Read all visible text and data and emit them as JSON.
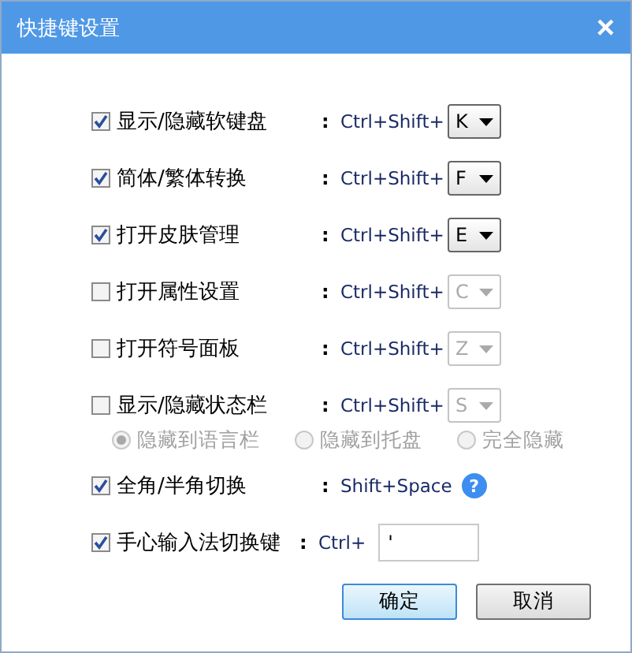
{
  "window": {
    "title": "快捷键设置",
    "close": "×"
  },
  "rows": [
    {
      "kind": "shortcut",
      "label": "显示/隐藏软键盘",
      "checked": true,
      "colon": ":",
      "prefix": "Ctrl+Shift+",
      "key": "K"
    },
    {
      "kind": "shortcut",
      "label": "简体/繁体转换",
      "checked": true,
      "colon": ":",
      "prefix": "Ctrl+Shift+",
      "key": "F"
    },
    {
      "kind": "shortcut",
      "label": "打开皮肤管理",
      "checked": true,
      "colon": ":",
      "prefix": "Ctrl+Shift+",
      "key": "E"
    },
    {
      "kind": "shortcut",
      "label": "打开属性设置",
      "checked": false,
      "colon": ":",
      "prefix": "Ctrl+Shift+",
      "key": "C"
    },
    {
      "kind": "shortcut",
      "label": "打开符号面板",
      "checked": false,
      "colon": ":",
      "prefix": "Ctrl+Shift+",
      "key": "Z"
    },
    {
      "kind": "shortcut",
      "label": "显示/隐藏状态栏",
      "checked": false,
      "colon": ":",
      "prefix": "Ctrl+Shift+",
      "key": "S"
    },
    {
      "kind": "radios",
      "options": [
        {
          "label": "隐藏到语言栏",
          "selected": true,
          "disabled": true
        },
        {
          "label": "隐藏到托盘",
          "selected": false,
          "disabled": true
        },
        {
          "label": "完全隐藏",
          "selected": false,
          "disabled": true
        }
      ]
    },
    {
      "kind": "fixed",
      "label": "全角/半角切换",
      "checked": true,
      "colon": ":",
      "prefix": "Shift+Space",
      "help": "?"
    },
    {
      "kind": "input",
      "label": "手心输入法切换键",
      "checked": true,
      "colon": ":",
      "prefix": "Ctrl+",
      "value": "'"
    }
  ],
  "buttons": [
    {
      "label": "确定",
      "default": true
    },
    {
      "label": "取消",
      "default": false
    }
  ]
}
